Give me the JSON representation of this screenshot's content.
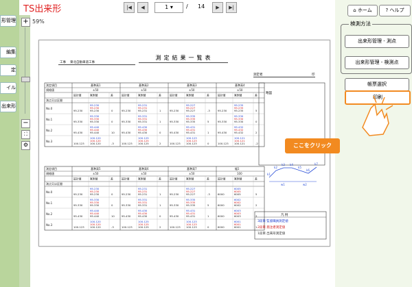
{
  "app_title": "TS出来形",
  "nav_tabs": [
    "形管理",
    "編集",
    "定",
    "イル",
    "出来形"
  ],
  "toolbar": {
    "page_current": "1",
    "page_total": "14",
    "slash": "/",
    "zoom": "59%"
  },
  "document": {
    "title": "測定結果一覧表",
    "project_label": "工事",
    "project_name": "東北自動車道工事",
    "surveyor_label": "測定者",
    "surveyor_suffix": "印",
    "sketch_label": "略図",
    "legend_title": "凡 例",
    "legend_items": [
      {
        "text": "3段目 監督職員測定値",
        "color": "#1a3ad0"
      },
      {
        "text": "2段目 発注者測定値",
        "color": "#d01a1a"
      },
      {
        "text": "1段目 出来形測定値",
        "color": "#333333"
      }
    ],
    "table1": {
      "row_labels": [
        "測定項目",
        "規格値",
        "",
        "測点又は区間",
        "No.0",
        "No.1",
        "No.2",
        "No.3"
      ],
      "col_headers": [
        "基準高1",
        "基準高2",
        "基準高3",
        "基準高4"
      ],
      "sub_headers": [
        "設計値",
        "実測値",
        "差"
      ],
      "tolerance": "±50",
      "rows": [
        {
          "station": "No.0",
          "vals": [
            [
              "95.230",
              "95.230",
              "0"
            ],
            [
              "95.230",
              "95.231",
              "1"
            ],
            [
              "95.230",
              "95.227",
              "-3"
            ],
            [
              "95.230",
              "95.235",
              "5"
            ]
          ]
        },
        {
          "station": "No.1",
          "vals": [
            [
              "95.330",
              "95.330",
              "0"
            ],
            [
              "95.330",
              "95.331",
              "1"
            ],
            [
              "95.330",
              "95.335",
              "5"
            ],
            [
              "95.330",
              "95.330",
              "0"
            ]
          ]
        },
        {
          "station": "No.2",
          "vals": [
            [
              "95.430",
              "95.440",
              "10"
            ],
            [
              "95.430",
              "95.430",
              "0"
            ],
            [
              "95.430",
              "95.431",
              "1"
            ],
            [
              "95.430",
              "95.432",
              "2"
            ]
          ]
        },
        {
          "station": "No.3",
          "vals": [
            [
              "100.123",
              "100.120",
              "-3"
            ],
            [
              "100.123",
              "100.125",
              "2"
            ],
            [
              "100.123",
              "100.123",
              "0"
            ],
            [
              "100.123",
              "100.121",
              "-2"
            ]
          ]
        }
      ]
    },
    "table2": {
      "row_labels": [
        "測定項目",
        "規格値",
        "",
        "測点又は区間",
        "No.0",
        "No.1",
        "No.2",
        "No.3"
      ],
      "col_headers": [
        "基準高5",
        "基準高6",
        "基準高7",
        "幅1"
      ],
      "sub_headers": [
        "設計値",
        "実測値",
        "差"
      ],
      "tolerance": "±50",
      "tolerance_last": "100",
      "rows": [
        {
          "station": "No.0",
          "vals": [
            [
              "95.230",
              "95.230",
              "0"
            ],
            [
              "95.230",
              "95.231",
              "1"
            ],
            [
              "95.230",
              "95.227",
              "-3"
            ],
            [
              "6000",
              "6005",
              "5"
            ]
          ]
        },
        {
          "station": "No.1",
          "vals": [
            [
              "95.330",
              "95.330",
              "0"
            ],
            [
              "95.330",
              "95.331",
              "1"
            ],
            [
              "95.330",
              "95.335",
              "5"
            ],
            [
              "6000",
              "6002",
              "2"
            ]
          ]
        },
        {
          "station": "No.2",
          "vals": [
            [
              "95.430",
              "95.440",
              "10"
            ],
            [
              "95.430",
              "95.430",
              "0"
            ],
            [
              "95.430",
              "95.431",
              "1"
            ],
            [
              "6000",
              "6003",
              "3"
            ]
          ]
        },
        {
          "station": "No.3",
          "vals": [
            [
              "100.123",
              "100.120",
              "-3"
            ],
            [
              "100.123",
              "100.125",
              "2"
            ],
            [
              "100.123",
              "100.123",
              "0"
            ],
            [
              "6000",
              "6001",
              "1"
            ]
          ]
        }
      ]
    },
    "sketch_points": [
      "k1",
      "k2",
      "k3",
      "k4",
      "k5",
      "k6",
      "k7",
      "w1",
      "w2"
    ]
  },
  "right_panel": {
    "home": "ホーム",
    "help": "ヘルプ",
    "group_title": "検測方法",
    "btn_survey": "出来形管理 - 測点",
    "btn_inspect": "出来形管理 - 検測点",
    "btn_form": "帳票選択",
    "btn_print": "印刷"
  },
  "callout": "ここをクリック",
  "colors": {
    "accent": "#f28a20",
    "title_red": "#e02020",
    "bg_green": "#a8c88a"
  }
}
